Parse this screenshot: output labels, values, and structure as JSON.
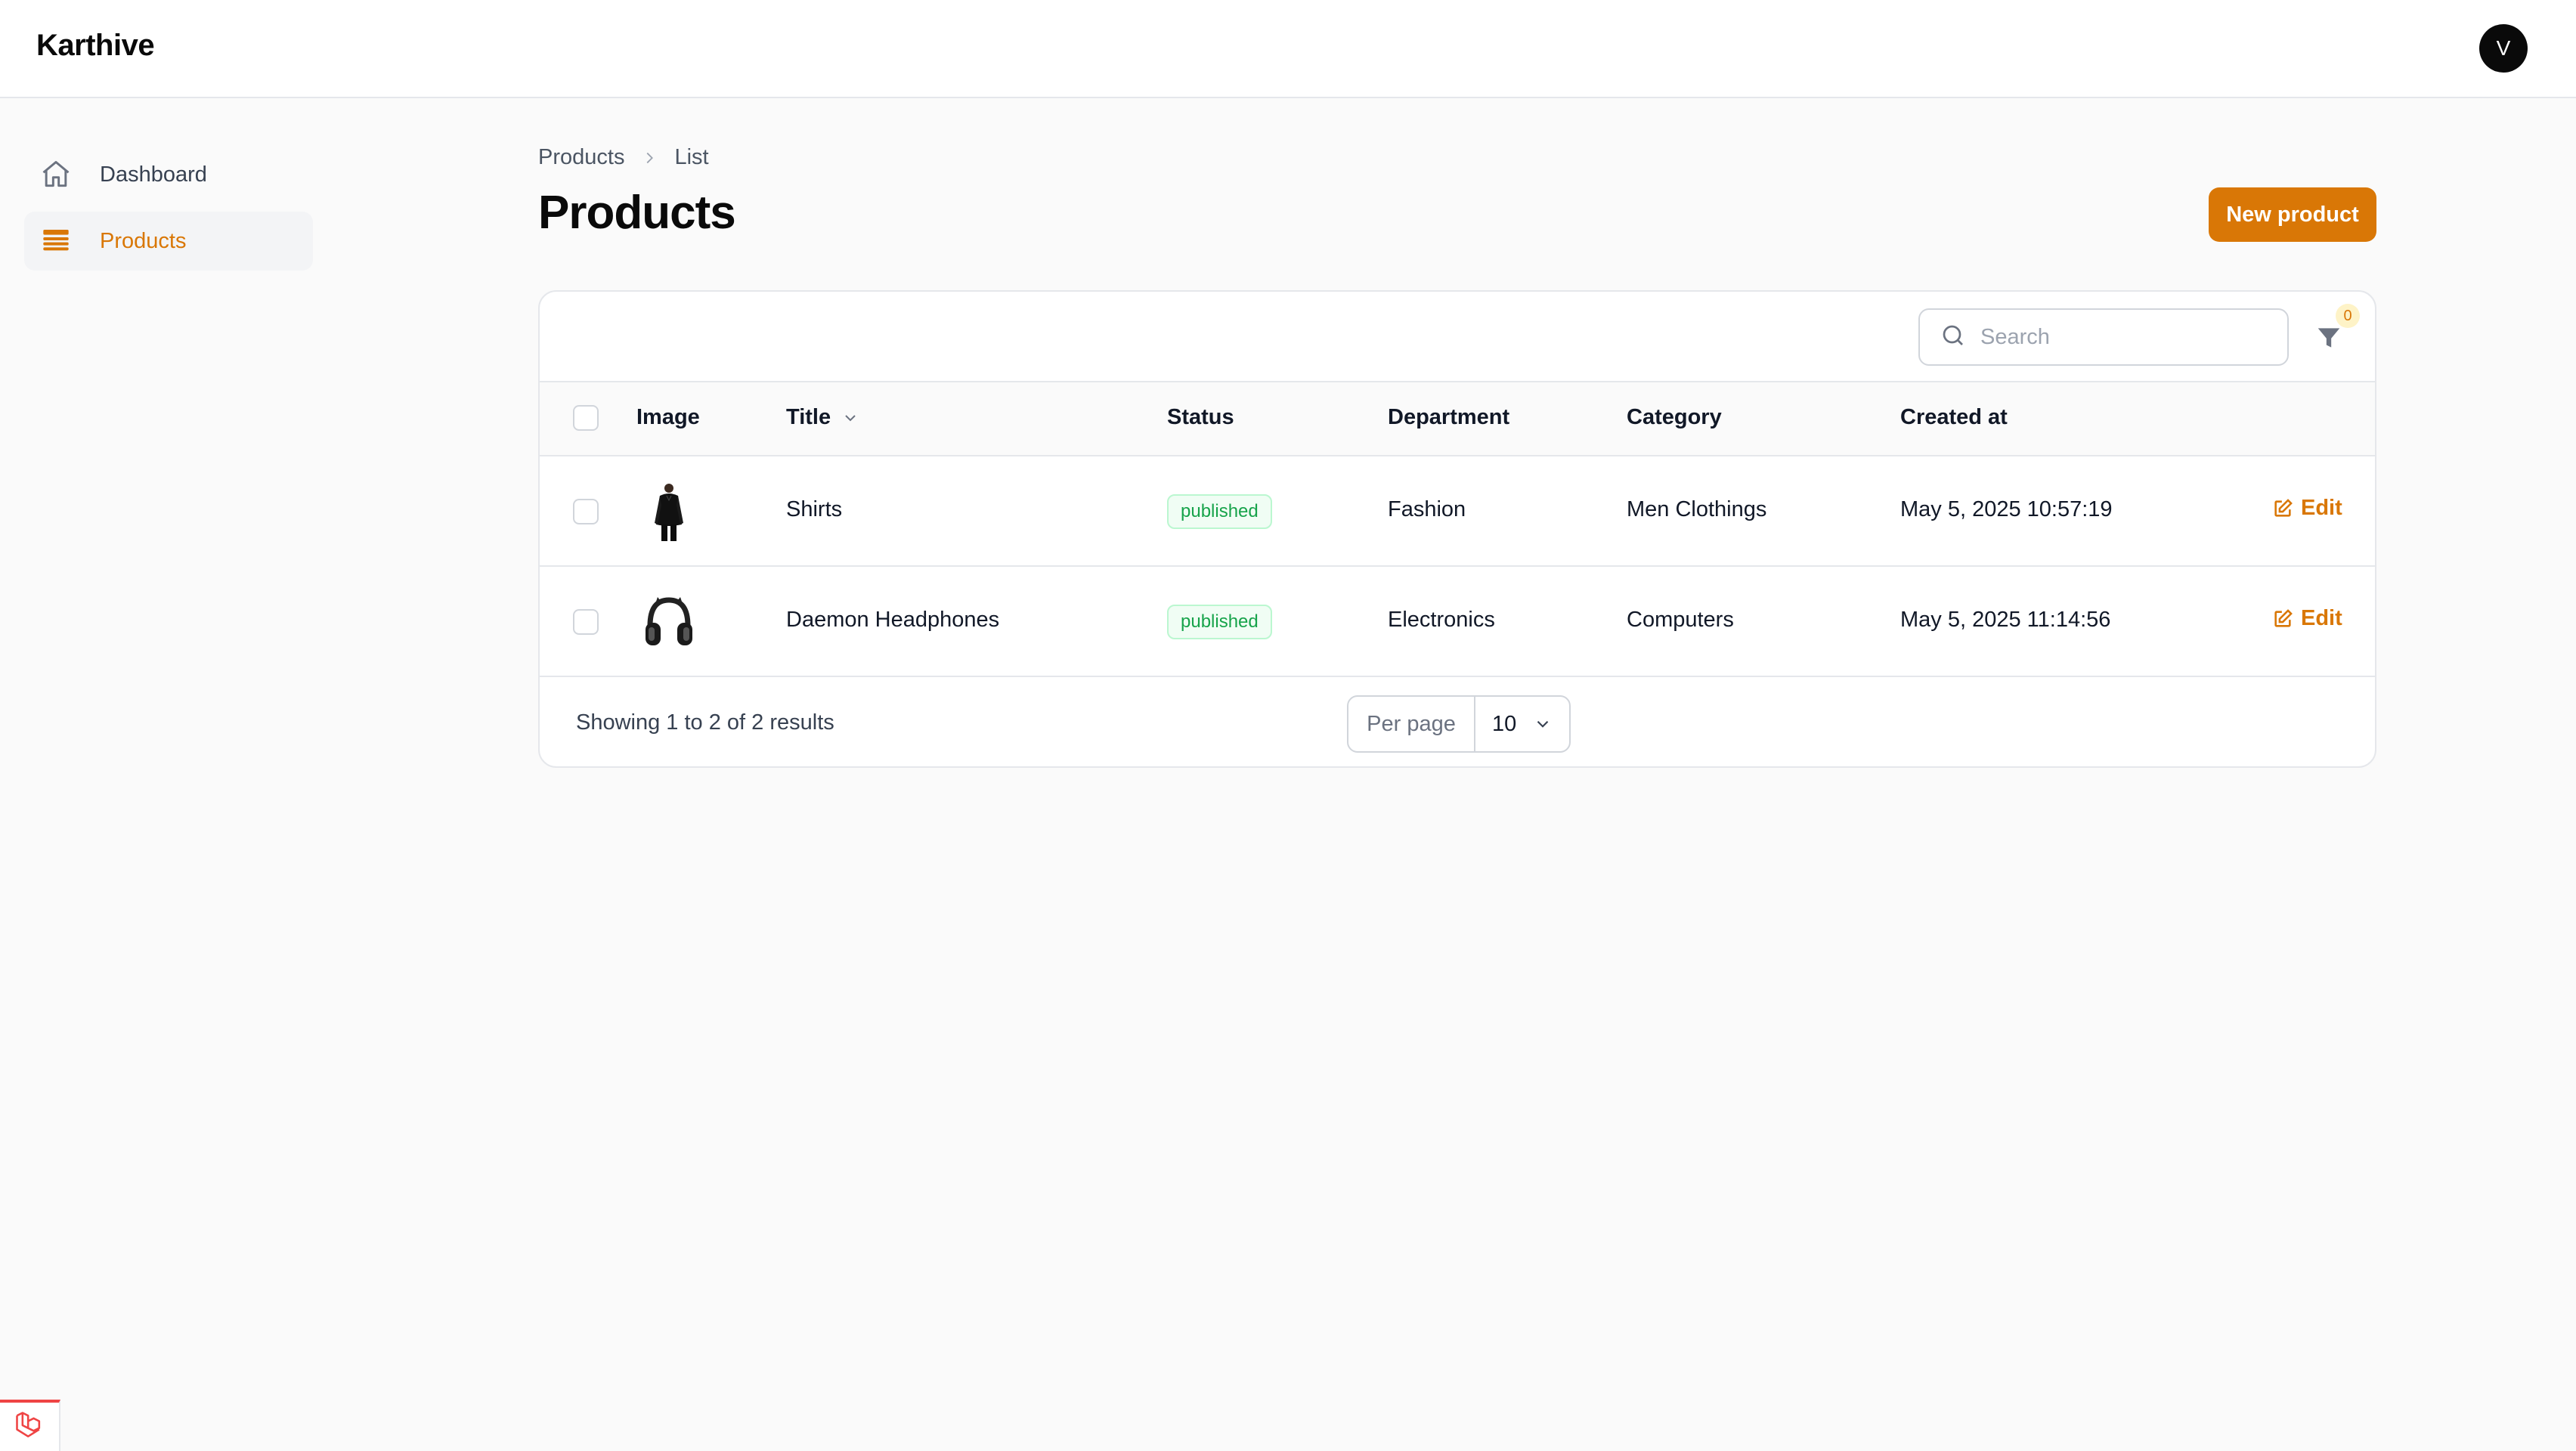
{
  "app": {
    "brand": "Karthive",
    "avatar_initial": "V",
    "accent": "#d97706"
  },
  "sidebar": {
    "items": [
      {
        "label": "Dashboard",
        "icon": "home-icon",
        "active": false
      },
      {
        "label": "Products",
        "icon": "list-icon",
        "active": true
      }
    ]
  },
  "breadcrumb": {
    "items": [
      "Products",
      "List"
    ]
  },
  "page": {
    "title": "Products",
    "new_button_label": "New product"
  },
  "toolbar": {
    "search_placeholder": "Search",
    "search_value": "",
    "filter_count": "0"
  },
  "table": {
    "columns": [
      "Image",
      "Title",
      "Status",
      "Department",
      "Category",
      "Created at"
    ],
    "sorted_column": "Title",
    "rows": [
      {
        "image": "shirt-thumbnail",
        "title": "Shirts",
        "status": "published",
        "department": "Fashion",
        "category": "Men Clothings",
        "created_at": "May 5, 2025 10:57:19",
        "action": "Edit"
      },
      {
        "image": "headphones-thumbnail",
        "title": "Daemon Headphones",
        "status": "published",
        "department": "Electronics",
        "category": "Computers",
        "created_at": "May 5, 2025 11:14:56",
        "action": "Edit"
      }
    ]
  },
  "pagination": {
    "summary": "Showing 1 to 2 of 2 results",
    "per_page_label": "Per page",
    "per_page_value": "10"
  }
}
